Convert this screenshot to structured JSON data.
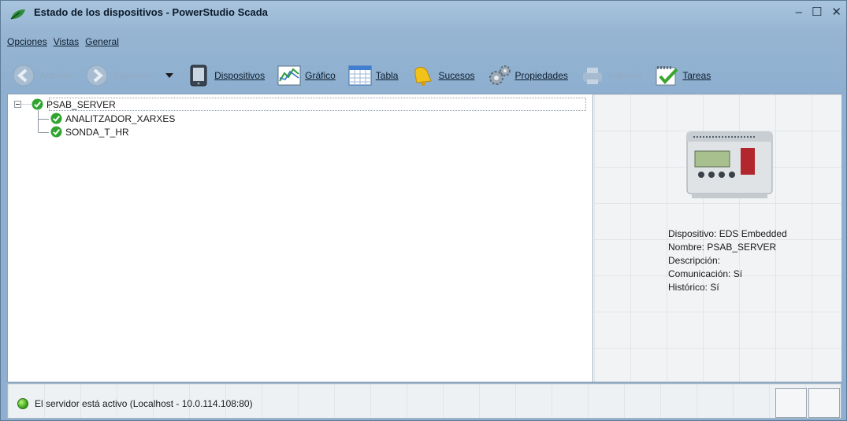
{
  "window": {
    "title": "Estado de los dispositivos - PowerStudio Scada",
    "minimize": "–",
    "maximize": "☐",
    "close": "✕"
  },
  "menu": [
    "Opciones",
    "Vistas",
    "General"
  ],
  "toolbar": {
    "back": "Anterior",
    "forward": "Siguiente",
    "devices": "Dispositivos",
    "chart": "Gráfico",
    "table": "Tabla",
    "events": "Sucesos",
    "properties": "Propiedades",
    "print": "Imprimir",
    "tasks": "Tareas"
  },
  "tree": {
    "root": "PSAB_SERVER",
    "children": [
      "ANALITZADOR_XARXES",
      "SONDA_T_HR"
    ]
  },
  "details": {
    "device": "Dispositivo: EDS Embedded",
    "name": "Nombre: PSAB_SERVER",
    "description": "Descripción:",
    "communication": "Comunicación: Sí",
    "history": "Histórico: Sí"
  },
  "status": {
    "text": "El servidor está activo (Localhost - 10.0.114.108:80)"
  },
  "colors": {
    "check_green": "#2fa52f",
    "title_bar": "#a9c4dd"
  }
}
